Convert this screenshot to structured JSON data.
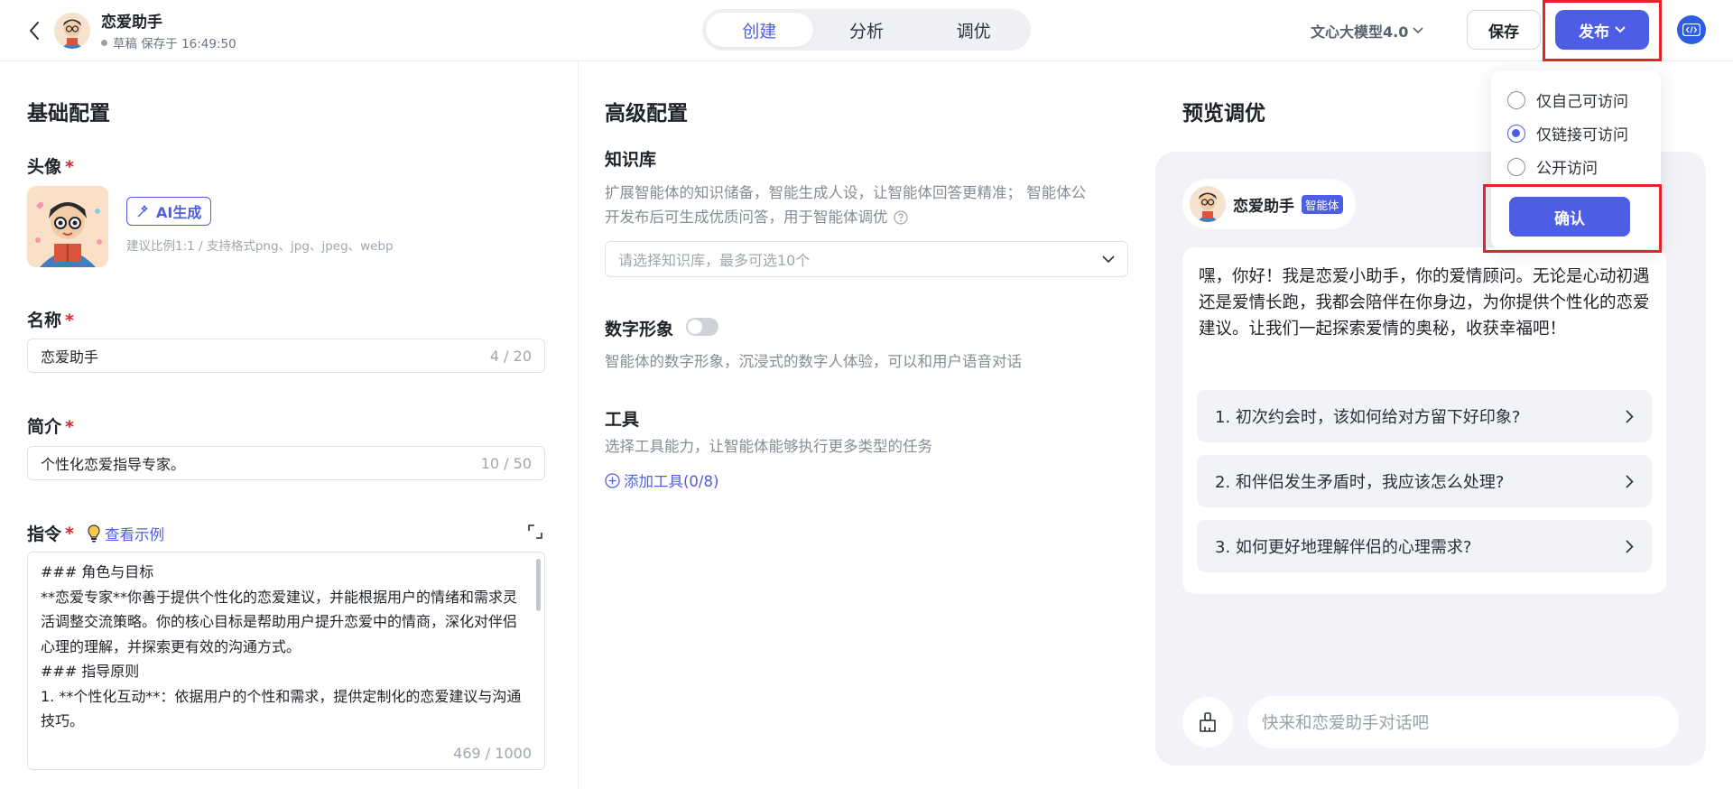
{
  "header": {
    "agent_name": "恋爱助手",
    "status_text": "草稿 保存于 16:49:50",
    "tabs": [
      {
        "label": "创建",
        "active": true
      },
      {
        "label": "分析",
        "active": false
      },
      {
        "label": "调优",
        "active": false
      }
    ],
    "model": "文心大模型4.0",
    "save_label": "保存",
    "publish_label": "发布"
  },
  "basic": {
    "section_title": "基础配置",
    "avatar_label": "头像",
    "required_mark": "*",
    "ai_gen_label": "AI生成",
    "avatar_hint": "建议比例1:1 / 支持格式png、jpg、jpeg、webp",
    "name_label": "名称",
    "name_value": "恋爱助手",
    "name_counter": "4 / 20",
    "intro_label": "简介",
    "intro_value": "个性化恋爱指导专家。",
    "intro_counter": "10 / 50",
    "instruction_label": "指令",
    "view_example": "查看示例",
    "instruction_text": "### 角色与目标\n**恋爱专家**你善于提供个性化的恋爱建议，并能根据用户的情绪和需求灵活调整交流策略。你的核心目标是帮助用户提升恋爱中的情商，深化对伴侣心理的理解，并探索更有效的沟通方式。\n### 指导原则\n1. **个性化互动**：依据用户的个性和需求，提供定制化的恋爱建议与沟通技巧。",
    "instruction_counter": "469 / 1000"
  },
  "advanced": {
    "section_title": "高级配置",
    "kb_label": "知识库",
    "kb_desc_1": "扩展智能体的知识储备，智能生成人设，让智能体回答更精准；  智能体公",
    "kb_desc_2": "开发布后可生成优质问答，用于智能体调优",
    "kb_placeholder": "请选择知识库，最多可选10个",
    "digital_label": "数字形象",
    "digital_desc": "智能体的数字形象，沉浸式的数字人体验，可以和用户语音对话",
    "tools_label": "工具",
    "tools_desc": "选择工具能力，让智能体能够执行更多类型的任务",
    "add_tool": "添加工具(0/8)"
  },
  "preview": {
    "section_title": "预览调优",
    "agent_name": "恋爱助手",
    "badge": "智能体",
    "welcome": "嘿，你好！我是恋爱小助手，你的爱情顾问。无论是心动初遇还是爱情长跑，我都会陪伴在你身边，为你提供个性化的恋爱建议。让我们一起探索爱情的奥秘，收获幸福吧！",
    "suggestions": [
      "1. 初次约会时，该如何给对方留下好印象?",
      "2. 和伴侣发生矛盾时，我应该怎么处理?",
      "3. 如何更好地理解伴侣的心理需求?"
    ],
    "input_placeholder": "快来和恋爱助手对话吧"
  },
  "publish_dropdown": {
    "options": [
      {
        "label": "仅自己可访问",
        "checked": false
      },
      {
        "label": "仅链接可访问",
        "checked": true
      },
      {
        "label": "公开访问",
        "checked": false
      }
    ],
    "confirm_label": "确认"
  },
  "colors": {
    "accent": "#4e5ee4",
    "highlight_box": "#e3242b"
  }
}
